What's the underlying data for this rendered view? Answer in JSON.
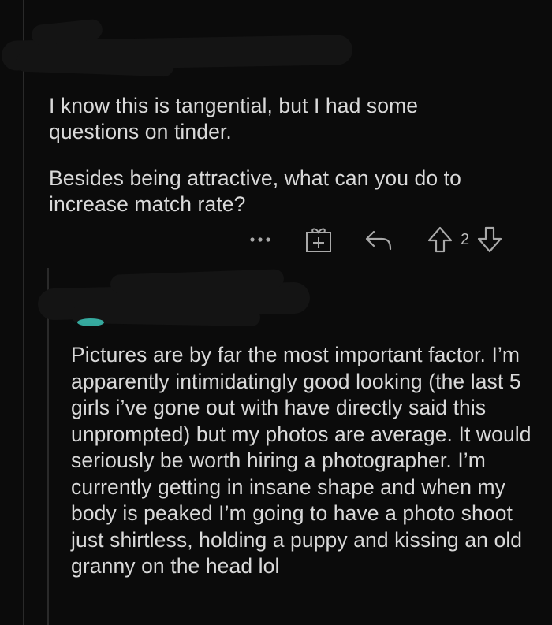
{
  "comment_1": {
    "paragraphs": [
      "I know this is tangential, but I had some questions on tinder.",
      "Besides being attractive, what can you do to increase match rate?"
    ],
    "actions": {
      "more_icon": "more-dots-icon",
      "award_icon": "award-gift-icon",
      "reply_icon": "reply-icon",
      "upvote_icon": "upvote-arrow-icon",
      "vote_count": "2",
      "downvote_icon": "downvote-arrow-icon"
    }
  },
  "comment_2": {
    "text": "Pictures are by far the most important factor. I’m apparently intimidatingly good looking (the last 5 girls i’ve gone out with have directly said this unprompted) but my photos are average. It would seriously be worth hiring a photographer. I’m currently getting in insane shape and when my body is peaked I’m going to have a photo shoot just shirtless, holding a puppy and kissing an old granny on the head lol"
  },
  "colors": {
    "background": "#0b0b0b",
    "text": "#d9d9d9",
    "icon": "#a9a9a9",
    "avatar_accent": "#3fd0c2"
  }
}
